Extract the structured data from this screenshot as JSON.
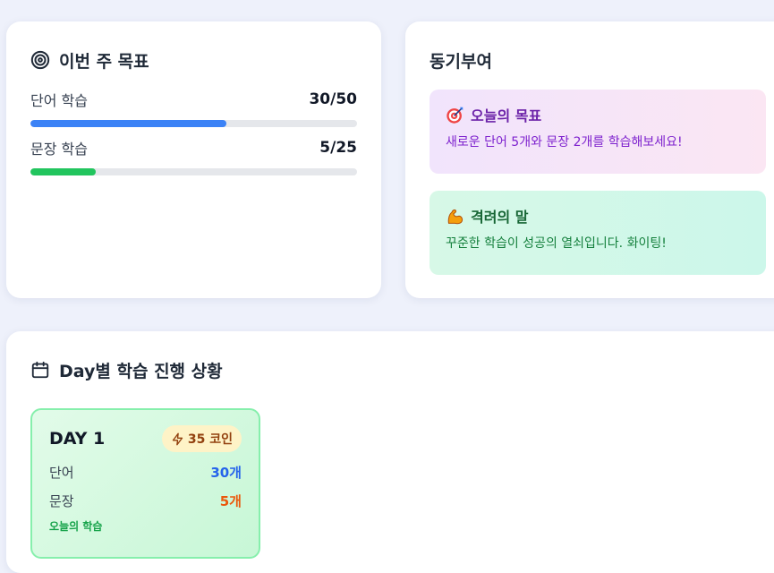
{
  "weekly_goals": {
    "title": "이번 주 목표",
    "icon": "target-icon",
    "items": [
      {
        "label": "단어 학습",
        "count": "30/50",
        "progress": 0.6,
        "color": "#3b82f6"
      },
      {
        "label": "문장 학습",
        "count": "5/25",
        "progress": 0.2,
        "color": "#22c55e"
      }
    ]
  },
  "motivation": {
    "title": "동기부여",
    "boxes": [
      {
        "emoji": "dart-icon",
        "title": "오늘의 목표",
        "text": "새로운 단어 5개와 문장 2개를 학습해보세요!"
      },
      {
        "emoji": "flexed-biceps-icon",
        "title": "격려의 말",
        "text": "꾸준한 학습이 성공의 열쇠입니다. 화이팅!"
      }
    ]
  },
  "day_progress": {
    "title": "Day별 학습 진행 상황",
    "icon": "calendar-icon",
    "days": [
      {
        "title": "DAY 1",
        "coins": "35 코인",
        "words_label": "단어",
        "words_value": "30개",
        "sentences_label": "문장",
        "sentences_value": "5개",
        "status": "오늘의 학습"
      }
    ]
  }
}
